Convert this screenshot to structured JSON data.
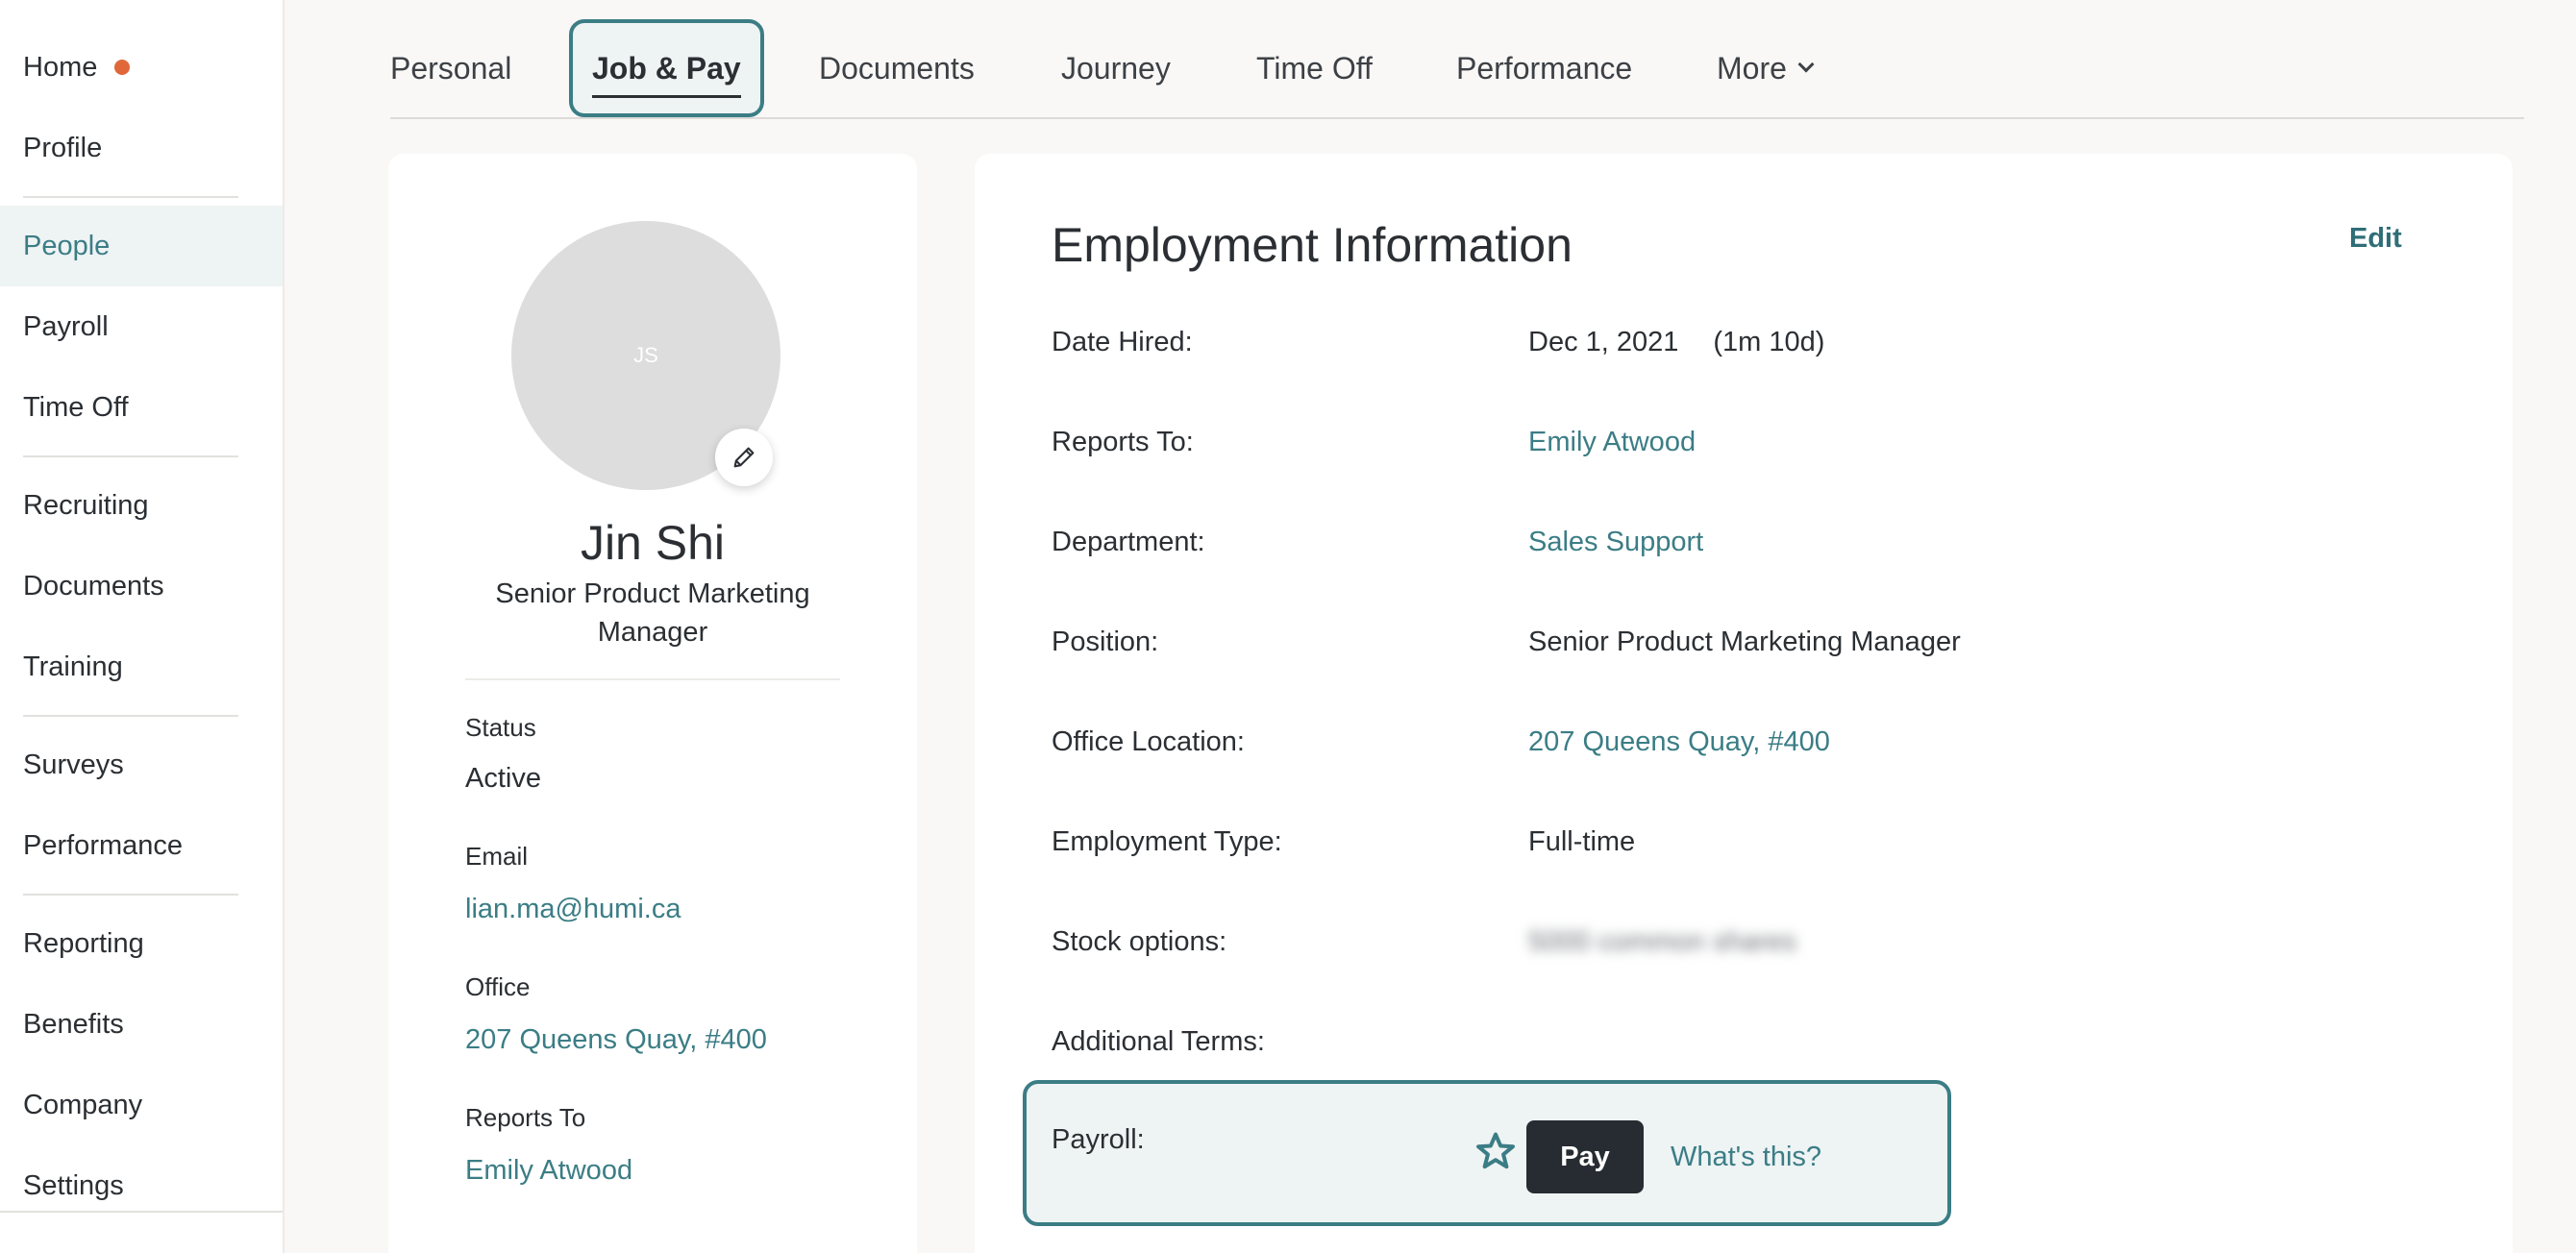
{
  "sidebar": {
    "items": [
      {
        "label": "Home",
        "has_dot": true
      },
      {
        "label": "Profile"
      },
      {
        "label": "People",
        "active": true
      },
      {
        "label": "Payroll"
      },
      {
        "label": "Time Off"
      },
      {
        "label": "Recruiting"
      },
      {
        "label": "Documents"
      },
      {
        "label": "Training"
      },
      {
        "label": "Surveys"
      },
      {
        "label": "Performance"
      },
      {
        "label": "Reporting"
      },
      {
        "label": "Benefits"
      },
      {
        "label": "Company"
      },
      {
        "label": "Settings"
      }
    ]
  },
  "tabs": [
    {
      "label": "Personal"
    },
    {
      "label": "Job & Pay",
      "active": true
    },
    {
      "label": "Documents"
    },
    {
      "label": "Journey"
    },
    {
      "label": "Time Off"
    },
    {
      "label": "Performance"
    },
    {
      "label": "More",
      "has_chevron": true
    }
  ],
  "profile": {
    "initials": "JS",
    "name": "Jin Shi",
    "title": "Senior Product Marketing Manager",
    "status_label": "Status",
    "status_value": "Active",
    "email_label": "Email",
    "email_value": "lian.ma@humi.ca",
    "office_label": "Office",
    "office_value": "207 Queens Quay, #400",
    "reports_to_label": "Reports To",
    "reports_to_value": "Emily Atwood"
  },
  "employment": {
    "title": "Employment Information",
    "edit_label": "Edit",
    "date_hired_label": "Date Hired:",
    "date_hired_value": "Dec 1, 2021",
    "date_hired_tenure": "(1m 10d)",
    "reports_to_label": "Reports To:",
    "reports_to_value": "Emily Atwood",
    "department_label": "Department:",
    "department_value": "Sales Support",
    "position_label": "Position:",
    "position_value": "Senior Product Marketing Manager",
    "office_location_label": "Office Location:",
    "office_location_value": "207 Queens Quay, #400",
    "employment_type_label": "Employment Type:",
    "employment_type_value": "Full-time",
    "stock_options_label": "Stock options:",
    "stock_options_value": "5000 common shares",
    "additional_terms_label": "Additional Terms:",
    "payroll_label": "Payroll:",
    "pay_button_label": "Pay",
    "whats_this_label": "What's this?"
  },
  "colors": {
    "accent": "#3b7d85",
    "notification_dot": "#e0673a",
    "dark_button": "#262c31"
  }
}
